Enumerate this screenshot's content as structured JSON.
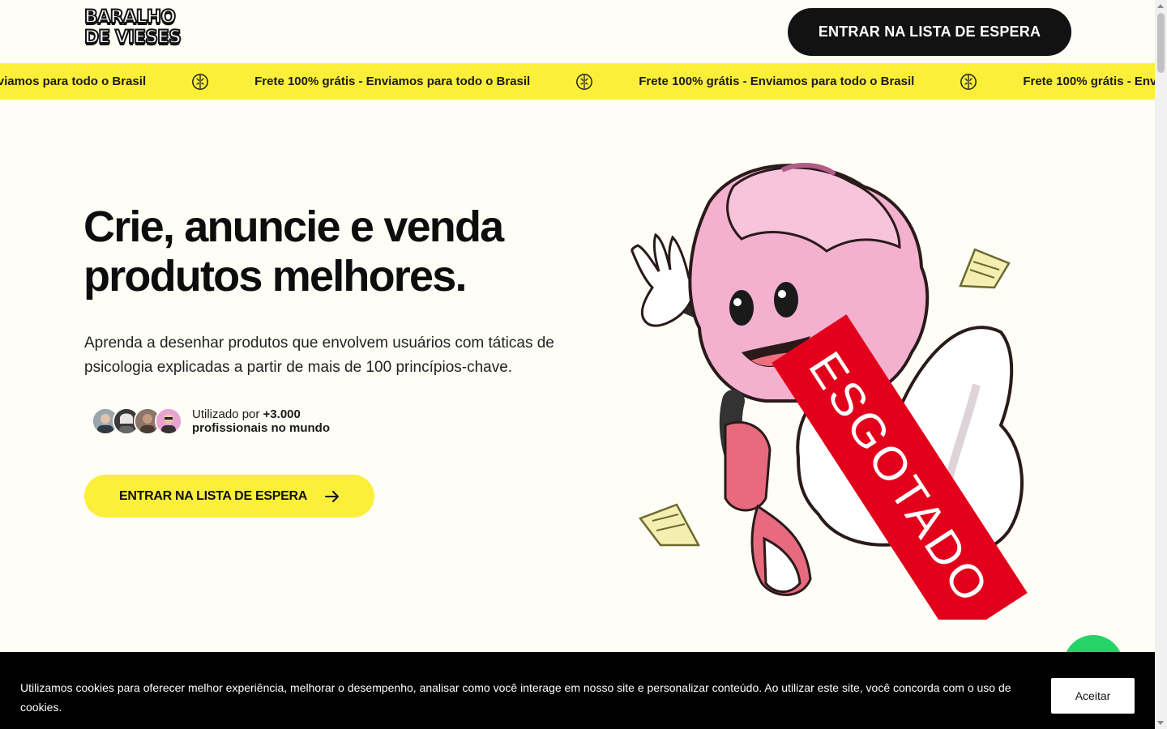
{
  "header": {
    "logo_line1": "BARALHO",
    "logo_line2": "DE VIESES",
    "cta_label": "ENTRAR NA LISTA DE ESPERA"
  },
  "marquee": {
    "items": [
      "Frete 100% grátis - Enviamos para todo o Brasil",
      "Frete 100% grátis - Enviamos para todo o Brasil",
      "Frete 100% grátis - Enviamos para todo o Brasil",
      "Frete 100% grátis - Enviamos para todo o Brasil"
    ],
    "icon": "brain-icon"
  },
  "hero": {
    "title_line1": "Crie, anuncie e venda",
    "title_line2": "produtos melhores.",
    "description": "Aprenda a desenhar produtos que envolvem usuários com táticas  de psicologia explicadas a partir de mais de 100 princípios-chave.",
    "proof_prefix": "Utilizado por ",
    "proof_count": "+3.000",
    "proof_suffix": "profissionais no mundo",
    "cta_label": "ENTRAR NA LISTA DE ESPERA",
    "sold_out_label": "ESGOTADO"
  },
  "cookie": {
    "text": "Utilizamos cookies para oferecer melhor experiência, melhorar o desempenho, analisar como você interage em nosso site e personalizar conteúdo. Ao utilizar este site, você concorda com o uso de cookies.",
    "accept_label": "Aceitar"
  },
  "colors": {
    "accent_yellow": "#fbef3a",
    "dark": "#121212",
    "background": "#fefdf6",
    "sold_out_red": "#e3001b",
    "whatsapp_green": "#25d366"
  }
}
